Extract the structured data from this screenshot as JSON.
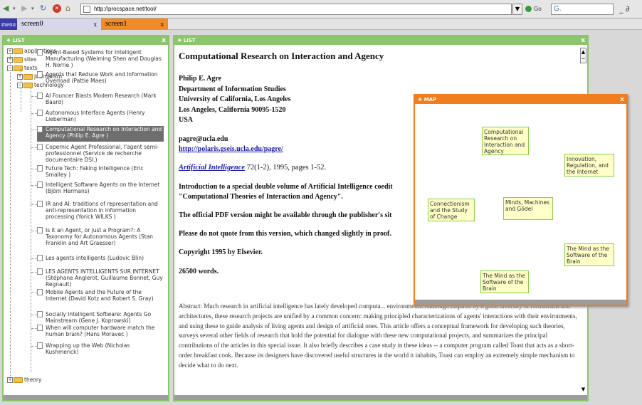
{
  "browser": {
    "url": "http://procspace.net/tool/",
    "go_label": "Go",
    "search_value": "G.",
    "window_controls": "_ ∂"
  },
  "tabs": {
    "menu_label": "menu",
    "items": [
      {
        "label": "screen0",
        "close": "x",
        "active": false
      },
      {
        "label": "screen1",
        "close": "x",
        "active": true
      }
    ]
  },
  "left_panel": {
    "header": "LIST",
    "close": "x",
    "tree": {
      "applications": "applications",
      "sites": "sites",
      "texts": "texts",
      "journalism": "journalism",
      "technology": "technology",
      "theory": "theory",
      "items": [
        "Agent-Based Systems for Intelligent Manufacturing (Weiming Shen and Douglas H. Norrie )",
        "Agents that Reduce Work and Information Overload (Pattie Maes)",
        "AI Founcer Blasts Modern Research (Mark Baard)",
        "Autonomous Interface Agents (Henry Lieberman)",
        "Computational Research on Interaction and Agency (Philip E. Agre )",
        "Copernic Agent Professional, l'agent semi-professionnel (Service de recherche documentaire DSI.)",
        "Future Tech: Faking Intelligence (Eric Smalley )",
        "Intelligent Software Agents on the Internet (Björn Hermans)",
        "IR and AI: traditions of representation and anti-representation in information processing (Yorick WILKS )",
        "Is it an Agent, or just a Program?: A Taxonomy for Autonomous Agents (Stan Franklin and Art Graesser)",
        "Les agents intelligents (Ludovic Blin)",
        "LES AGENTS INTELLIGENTS SUR INTERNET (Stéphane Anglerot, Guillaume Bonnet, Guy Regnault)",
        "Mobile Agents and the Future of the Internet (David Kotz and Robert S. Gray)",
        "Socially Intelligent Software: Agents Go Mainstream (Gene J. Koprowski)",
        "When will computer hardware match the human brain? (Hans Moravec )",
        "Wrapping up the Web (Nicholas Kushmerick)"
      ],
      "selected_index": 4
    }
  },
  "doc_panel": {
    "header": "LIST",
    "close": "x",
    "title": "Computational Research on Interaction and Agency",
    "author": "Philip E. Agre",
    "dept": "Department of Information Studies",
    "univ": "University of California, Los Angeles",
    "addr": "Los Angeles, California 90095-1520",
    "country": "USA",
    "email": "pagre@ucla.edu",
    "url": "http://polaris.gseis.ucla.edu/pagre/",
    "journal": "Artificial Intelligence",
    "journal_ref": " 72(1-2), 1995, pages 1-52.",
    "intro": "Introduction to a special double volume of Artificial Intelligence coedit",
    "intro2": "\"Computational Theories of Interaction and Agency\".",
    "pdf_note": "The official PDF version might be available through the publisher's sit",
    "quote_note": "Please do not quote from this version, which changed slightly in proof.",
    "copyright": "Copyright 1995 by Elsevier.",
    "words": "26500 words.",
    "abstract": "Abstract: Much research in artificial intelligence has lately developed computa... environments. Although inspired by a great diversity of formalisms and architectures, these research projects are unified by a common concern: making principled characterizations of agents' interactions with their environments, and using these to guide analysis of living agents and design of artificial ones. This article offers a conceptual framework for developing such theories, surveys several other fields of research that hold the potential for dialogue with these new computational projects, and summarizes the principal contributions of the articles in this special issue. It also briefly describes a case study in these ideas -- a computer program called Toast that acts as a short-order breakfast cook. Because its designers have discovered useful structures in the world it inhabits, Toast can employ an extremely simple mechanism to decide what to do next."
  },
  "map_panel": {
    "header": "MAP",
    "close": "x",
    "nodes": [
      "Computational Research on Interaction and Agency",
      "Innovation, Regulation, and the Internet",
      "Connectionism and the Study of Change",
      "Minds, Machines and Gödel",
      "The Mind as the Software of the Brain",
      "The Mind as the Software of the Brain"
    ]
  },
  "colors": {
    "panel_green": "#8cc66c",
    "map_orange": "#f07d1e",
    "tab_active": "#f08c2a",
    "menu_blue": "#3a3aa8",
    "node_fill": "#ffffc8"
  }
}
